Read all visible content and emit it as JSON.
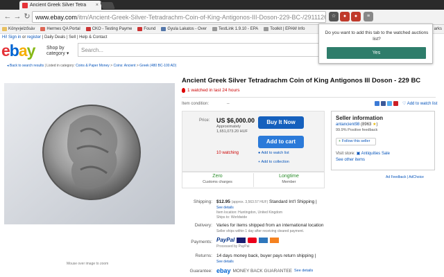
{
  "browser": {
    "tab_title": "Ancient Greek Silver Tetra",
    "tab_close": "×",
    "back_icon": "back-arrow-icon",
    "url_host": "www.ebay.com",
    "url_path": "/itm/Ancient-Greek-Silver-Tetradrachm-Coin-of-King-Antigonos-III-Doson-229-BC-/291112687196?hash=item43c7ab165c:g:DZ0AA",
    "bookmarks": [
      "Könyvjelzősáv",
      "Hermes QA Portal",
      "CKO - Testing Payme",
      "Found",
      "Gyula Lakatos - Over",
      "TestLink 1.9.10 - EPA",
      "Toolkit | EPAM Info",
      "arks"
    ]
  },
  "popup": {
    "message": "Do you want to add this tab to the watched auctions list?",
    "yes_label": "Yes"
  },
  "ebay": {
    "topnav_signin": "Hi! Sign in",
    "topnav_or": " or ",
    "topnav_register": "register",
    "topnav_rest": "  |  Daily Deals  |  Sell  |  Help & Contact",
    "logo": {
      "e": "e",
      "b": "b",
      "a": "a",
      "y": "y"
    },
    "colors": {
      "e": "#e53238",
      "b": "#0064d2",
      "a": "#f5af02",
      "y": "#86b817"
    },
    "shop_by": "Shop by",
    "category": "category",
    "search_placeholder": "Search...",
    "back_results": "Back to search results",
    "listed_in": "  |  Listed in category:",
    "crumbs": [
      "Coins & Paper Money",
      "Coins: Ancient",
      "Greek (480 BC-100 AD)"
    ],
    "mouse_over": "Mouse over image to zoom"
  },
  "item": {
    "title": "Ancient Greek Silver Tetradrachm Coin of King Antigonos III Doson - 229 BC",
    "watched_notice": "1 watched in last 24 hours",
    "condition_label": "Item condition:",
    "condition_value": "--",
    "add_watch_link": "Add to watch list",
    "price_label": "Price:",
    "price": "US $6,000.00",
    "approx_label": "Approximately",
    "approx_value": "1,651,073.20 HUF",
    "buy_now": "Buy It Now",
    "add_cart": "Add to cart",
    "watching": "10 watching",
    "add_watchlist": "Add to watch list",
    "add_collection": "Add to collection",
    "customs_value": "Zero",
    "customs_label": "Customs charges",
    "member_value": "Longtime",
    "member_label": "Member"
  },
  "seller": {
    "heading": "Seller information",
    "name": "antancient98",
    "score": "(8963",
    "positive": "99.9% Positive feedback",
    "follow": "Follow this seller",
    "visit_store": "Visit store:",
    "store_name": "Antiquities Sale",
    "other_items": "See other items"
  },
  "ads": {
    "feedback": "Ad Feedback",
    "adchoice": "AdChoice"
  },
  "shipping": {
    "label": "Shipping:",
    "cost": "$12.95",
    "approx": "(approx. 3,563.57 HUF)",
    "service": "Standard Int'l Shipping |",
    "details": "See details",
    "location": "Item location:  Huntingdon, United Kingdom",
    "ships_to": "Ships to:  Worldwide"
  },
  "delivery": {
    "label": "Delivery:",
    "value": "Varies for items shipped from an international location",
    "sub": "Seller ships within 1 day after receiving cleared payment."
  },
  "payments": {
    "label": "Payments:",
    "paypal": "PayPal",
    "processed": "Processed by PayPal"
  },
  "returns": {
    "label": "Returns:",
    "value": "14 days money back, buyer pays return shipping |",
    "details": "See details"
  },
  "guarantee": {
    "label": "Guarantee:",
    "ebay": "ebay",
    "text": "MONEY BACK GUARANTEE",
    "link": "See details"
  }
}
